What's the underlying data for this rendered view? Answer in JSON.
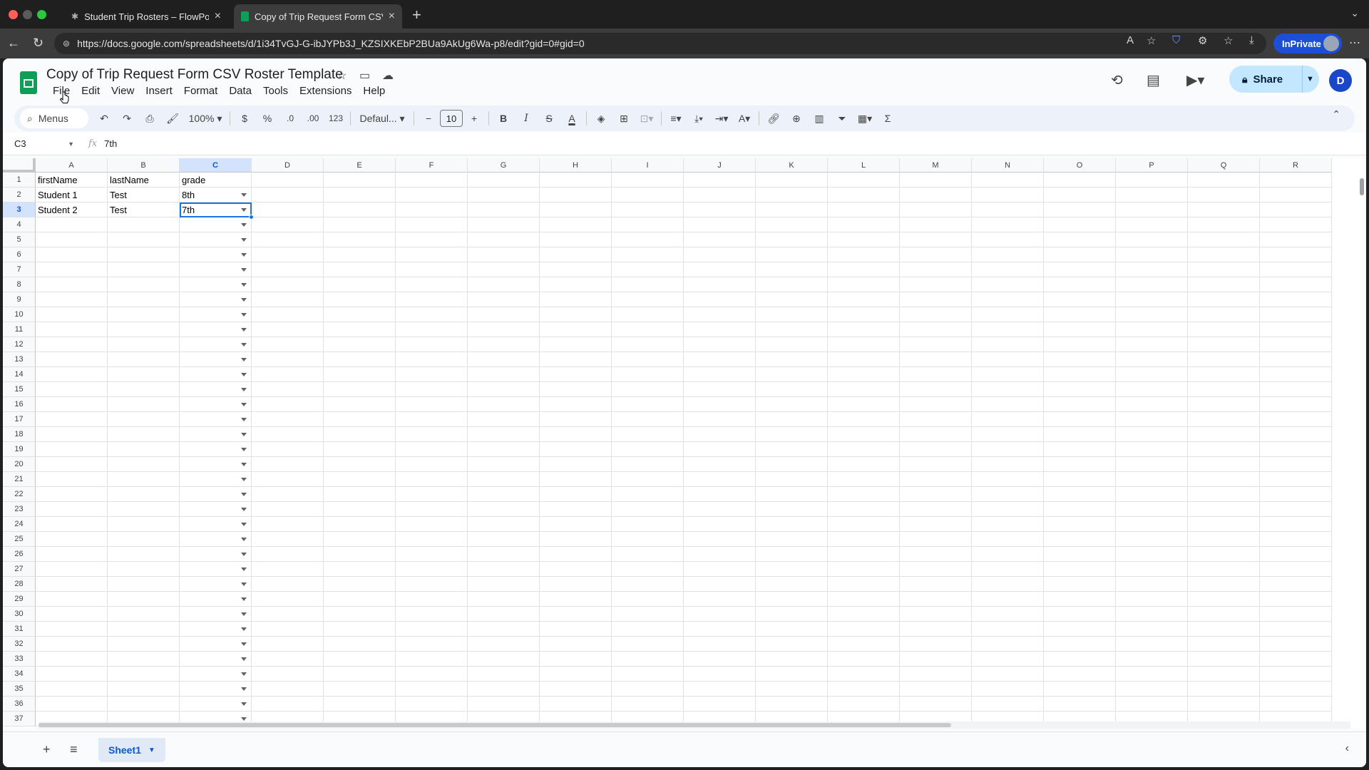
{
  "browser": {
    "tabs": [
      {
        "title": "Student Trip Rosters – FlowPoint"
      },
      {
        "title": "Copy of Trip Request Form CSV"
      }
    ],
    "url": "https://docs.google.com/spreadsheets/d/1i34TvGJ-G-ibJYPb3J_KZSIXKEbP2BUa9AkUg6Wa-p8/edit?gid=0#gid=0",
    "inprivate_label": "InPrivate"
  },
  "doc": {
    "title": "Copy of Trip Request Form CSV Roster Template",
    "menu": [
      "File",
      "Edit",
      "View",
      "Insert",
      "Format",
      "Data",
      "Tools",
      "Extensions",
      "Help"
    ],
    "share_label": "Share",
    "account_initial": "D"
  },
  "toolbar": {
    "menus_label": "Menus",
    "zoom": "100%",
    "currency": "$",
    "percent": "%",
    "dec_decrease": ".0",
    "dec_increase": ".00",
    "number_format": "123",
    "font": "Defaul...",
    "font_size": "10"
  },
  "formula_bar": {
    "cell_ref": "C3",
    "value": "7th"
  },
  "grid": {
    "columns": [
      "A",
      "B",
      "C",
      "D",
      "E",
      "F",
      "G",
      "H",
      "I",
      "J",
      "K",
      "L",
      "M",
      "N",
      "O",
      "P",
      "Q",
      "R"
    ],
    "selected_column": "C",
    "selected_row": 3,
    "row_count": 37,
    "cells": [
      [
        "firstName",
        "lastName",
        "grade"
      ],
      [
        "Student 1",
        "Test",
        "8th"
      ],
      [
        "Student 2",
        "Test",
        "7th"
      ]
    ],
    "dropdown_column": "C"
  },
  "sheets": {
    "active": "Sheet1"
  },
  "colors": {
    "accent": "#1a73e8",
    "share_bg": "#c2e7ff",
    "sheets_green": "#0f9d58"
  }
}
